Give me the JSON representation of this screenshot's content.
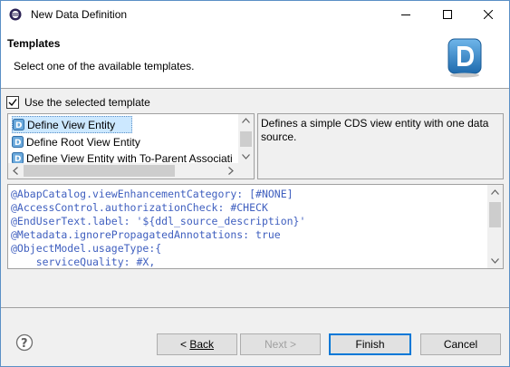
{
  "window": {
    "title": "New Data Definition"
  },
  "banner": {
    "title": "Templates",
    "message": "Select one of the available templates.",
    "logo_icon": "ddl-logo-icon"
  },
  "checkbox": {
    "label": "Use the selected template",
    "checked": true
  },
  "templates": {
    "items": [
      {
        "label": "Define View Entity",
        "selected": true
      },
      {
        "label": "Define Root View Entity",
        "selected": false
      },
      {
        "label": "Define View Entity with To-Parent Associati",
        "selected": false
      }
    ]
  },
  "description": {
    "text": "Defines a simple CDS view entity with one data source."
  },
  "code": {
    "lines": [
      "@AbapCatalog.viewEnhancementCategory: [#NONE]",
      "@AccessControl.authorizationCheck: #CHECK",
      "@EndUserText.label: '${ddl_source_description}'",
      "@Metadata.ignorePropagatedAnnotations: true",
      "@ObjectModel.usageType:{",
      "    serviceQuality: #X,"
    ]
  },
  "buttons": {
    "back": "Back",
    "back_prefix": "< ",
    "next": "Next >",
    "finish": "Finish",
    "cancel": "Cancel"
  },
  "colors": {
    "accent": "#0078d7",
    "selection": "#cce8ff",
    "code_text": "#3f5fbf"
  }
}
